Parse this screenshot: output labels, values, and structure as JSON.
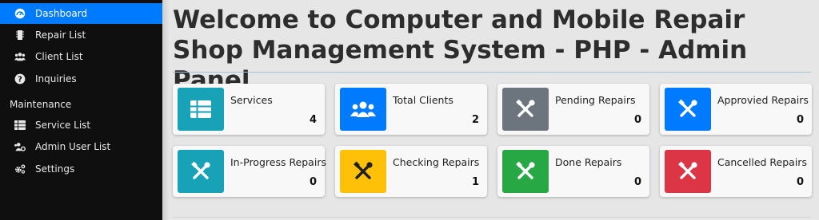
{
  "sidebar": {
    "items": [
      {
        "label": "Dashboard",
        "icon": "dashboard-icon",
        "active": true
      },
      {
        "label": "Repair List",
        "icon": "chip-icon"
      },
      {
        "label": "Client List",
        "icon": "users-icon"
      },
      {
        "label": "Inquiries",
        "icon": "question-icon"
      }
    ],
    "section_title": "Maintenance",
    "maintenance_items": [
      {
        "label": "Service List",
        "icon": "table-icon"
      },
      {
        "label": "Admin User List",
        "icon": "users-cog-icon"
      },
      {
        "label": "Settings",
        "icon": "cogs-icon"
      }
    ]
  },
  "main": {
    "title": "Welcome to Computer and Mobile Repair Shop Management System - PHP - Admin Panel",
    "cards": [
      {
        "label": "Services",
        "count": "4",
        "icon": "table-icon",
        "color": "#17a2b8"
      },
      {
        "label": "Total Clients",
        "count": "2",
        "icon": "users-icon",
        "color": "#007bff"
      },
      {
        "label": "Pending Repairs",
        "count": "0",
        "icon": "tools-icon",
        "color": "#6c757d"
      },
      {
        "label": "Approvied Repairs",
        "count": "0",
        "icon": "tools-icon",
        "color": "#007bff"
      },
      {
        "label": "In-Progress Repairs",
        "count": "0",
        "icon": "tools-icon",
        "color": "#17a2b8"
      },
      {
        "label": "Checking Repairs",
        "count": "1",
        "icon": "tools-icon",
        "color": "#ffc107"
      },
      {
        "label": "Done Repairs",
        "count": "0",
        "icon": "tools-icon",
        "color": "#28a745"
      },
      {
        "label": "Cancelled Repairs",
        "count": "0",
        "icon": "tools-icon",
        "color": "#dc3545"
      }
    ]
  }
}
